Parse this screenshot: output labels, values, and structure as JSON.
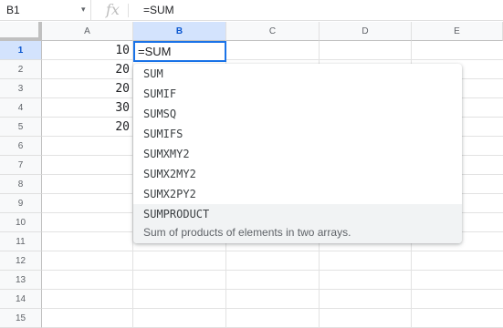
{
  "formula_bar": {
    "name_box": "B1",
    "name_box_caret": "▾",
    "fx": "fx",
    "formula": "=SUM"
  },
  "columns": [
    "A",
    "B",
    "C",
    "D",
    "E"
  ],
  "rows": [
    "1",
    "2",
    "3",
    "4",
    "5",
    "6",
    "7",
    "8",
    "9",
    "10",
    "11",
    "12",
    "13",
    "14",
    "15"
  ],
  "cells": {
    "A1": "10",
    "A2": "20",
    "A3": "20",
    "A4": "30",
    "A5": "20"
  },
  "active_cell": {
    "ref": "B1",
    "text": "=SUM"
  },
  "autocomplete": {
    "items": [
      "SUM",
      "SUMIF",
      "SUMSQ",
      "SUMIFS",
      "SUMXMY2",
      "SUMX2MY2",
      "SUMX2PY2",
      "SUMPRODUCT"
    ],
    "selected_description": "Sum of products of elements in two arrays."
  },
  "colors": {
    "accent": "#1a73e8",
    "header_active_bg": "#d3e3fd",
    "gridline": "#e2e2e2"
  }
}
